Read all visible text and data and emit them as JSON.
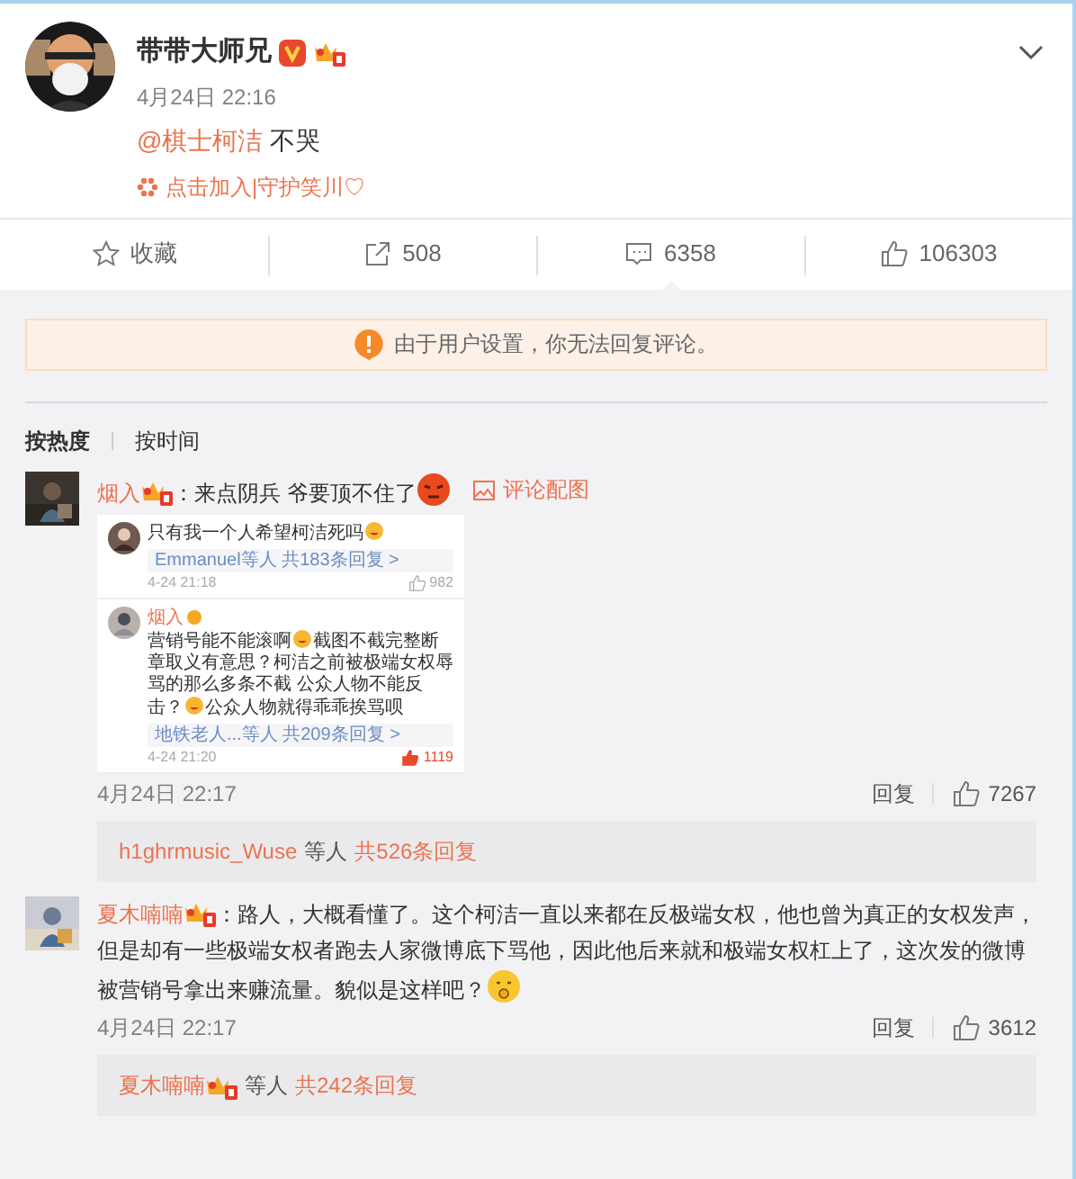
{
  "post": {
    "author": "带带大师兄",
    "time": "4月24日 22:16",
    "mention": "@棋士柯洁",
    "text": "不哭",
    "tagline": "点击加入|守护笑川♡"
  },
  "actions": [
    {
      "kind": "star",
      "label": "收藏",
      "selected": false
    },
    {
      "kind": "share",
      "label": "508",
      "selected": false
    },
    {
      "kind": "comment",
      "label": "6358",
      "selected": true
    },
    {
      "kind": "like",
      "label": "106303",
      "selected": false
    }
  ],
  "notice": "由于用户设置，你无法回复评论。",
  "sort_tabs": [
    {
      "label": "按热度",
      "selected": true
    },
    {
      "label": "按时间",
      "selected": false
    }
  ],
  "comments": [
    {
      "author": "烟入",
      "text": "：来点阴兵 爷要顶不住了",
      "emoji": {
        "kind": "angry"
      },
      "image_link": "评论配图",
      "screenshot": [
        {
          "parts": [
            {
              "kind": "text",
              "text": "只有我一个人希望柯洁死吗"
            },
            {
              "kind": "emoji"
            }
          ],
          "replies": "Emmanuel等人  共183条回复 >",
          "time": "4-24 21:18",
          "likes": "982",
          "liked": false
        },
        {
          "author": "烟入",
          "parts": [
            {
              "kind": "text",
              "text": "营销号能不能滚啊"
            },
            {
              "kind": "emoji"
            },
            {
              "kind": "text",
              "text": "截图不截完整断章取义有意思？柯洁之前被极端女权辱骂的那么多条不截 公众人物不能反击？"
            },
            {
              "kind": "emoji"
            },
            {
              "kind": "text",
              "text": "公众人物就得乖乖挨骂呗"
            }
          ],
          "replies": "地铁老人...等人  共209条回复 >",
          "time": "4-24 21:20",
          "likes": "1119",
          "liked": true
        }
      ],
      "time": "4月24日 22:17",
      "reply": "回复",
      "likes": "7267",
      "reply_users": "h1ghrmusic_Wuse",
      "reply_users_badge": false,
      "reply_suffix": "等人",
      "reply_count": "共526条回复"
    },
    {
      "author": "夏木喃喃",
      "text": "：路人，大概看懂了。这个柯洁一直以来都在反极端女权，他也曾为真正的女权发声，但是却有一些极端女权者跑去人家微博底下骂他，因此他后来就和极端女权杠上了，这次发的微博被营销号拿出来赚流量。貌似是这样吧？",
      "emoji": {
        "kind": "shush"
      },
      "time": "4月24日 22:17",
      "reply": "回复",
      "likes": "3612",
      "reply_users": "夏木喃喃",
      "reply_users_badge": true,
      "reply_suffix": "等人",
      "reply_count": "共242条回复"
    }
  ]
}
